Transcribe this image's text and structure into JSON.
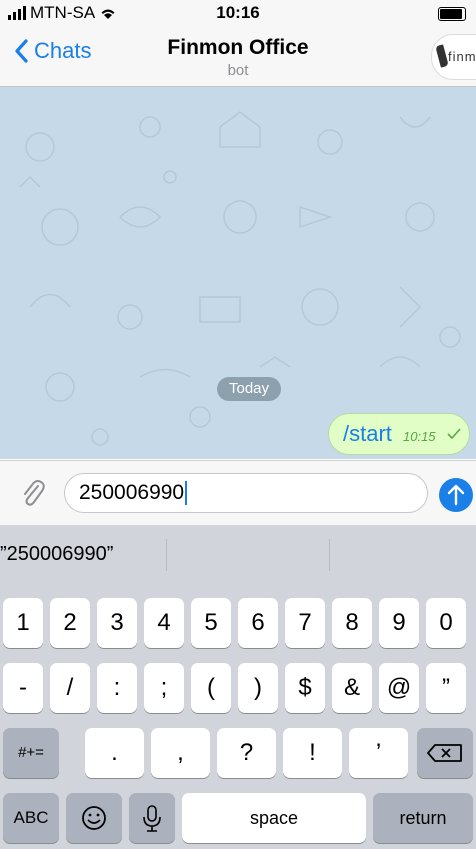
{
  "status_bar": {
    "carrier": "MTN-SA",
    "time": "10:16"
  },
  "header": {
    "back_label": "Chats",
    "title": "Finmon Office",
    "subtitle": "bot",
    "avatar_text": "finm"
  },
  "chat": {
    "date_divider": "Today",
    "messages": [
      {
        "text": "/start",
        "time": "10:15",
        "status": "read"
      }
    ]
  },
  "composer": {
    "input_value": "250006990"
  },
  "keyboard": {
    "suggestion": "”250006990”",
    "row1": [
      "1",
      "2",
      "3",
      "4",
      "5",
      "6",
      "7",
      "8",
      "9",
      "0"
    ],
    "row2": [
      "-",
      "/",
      ":",
      ";",
      "(",
      ")",
      "$",
      "&",
      "@",
      "”"
    ],
    "row3_symbols_key": "#+=",
    "row3": [
      ".",
      ",",
      "?",
      "!",
      "’"
    ],
    "abc_key": "ABC",
    "space_key": "space",
    "return_key": "return"
  },
  "colors": {
    "accent": "#1a7fe6",
    "bubble": "#e1fec6",
    "chat_bg": "#c6d9e8"
  }
}
